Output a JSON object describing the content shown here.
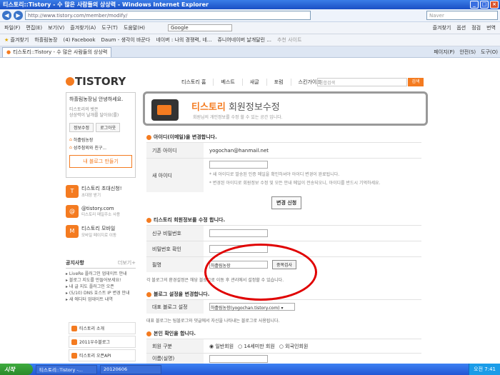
{
  "window": {
    "title": "티스토리::Tistory - 수 많은 사람들의 상상력 - Windows Internet Explorer"
  },
  "address": {
    "url": "http://www.tistory.com/member/modify/",
    "search_placeholder": "Naver"
  },
  "menubar": [
    "파일(F)",
    "편집(E)",
    "보기(V)",
    "즐겨찾기(A)",
    "도구(T)",
    "도움말(H)"
  ],
  "menubar_google": "Google",
  "menubar_right": [
    "즐겨찾기",
    "옵션",
    "점검",
    "번역"
  ],
  "favbar": {
    "label": "즐겨찾기",
    "items": [
      "하흘림농장",
      "(4) Facebook",
      "Daum - 생각이 바꾼다",
      "네이버 : 나의 경쟁력, 네...",
      "쥬니어네이버 날개달린 ...",
      "추천 사이트"
    ]
  },
  "tab": {
    "label": "티스토리::Tistory - 수 많은 사람들의 상상력",
    "tools": [
      "페이지(P)",
      "안전(S)",
      "도구(O)"
    ]
  },
  "site": {
    "logo": "TISTORY",
    "nav": [
      "티스토리 홈",
      "베스트",
      "새글",
      "포럼",
      "스킨가이드"
    ],
    "search_placeholder": "통합검색",
    "search_btn": "검색",
    "login": {
      "greet": "하흘림농장님 안녕하세요.",
      "desc1": "티스토리의 벗은",
      "desc2": "상상력이 날개를 달아요(를)",
      "btn_info": "정보수정",
      "btn_logout": "로그아웃",
      "blogs": [
        "하흘림농장",
        "성주참외와 친구..."
      ],
      "make": "내 블로그 만들기"
    },
    "promos": [
      {
        "title": "티스토리 초대신청!",
        "sub": "초대장 받기",
        "icon": "T"
      },
      {
        "title": "@tistory.com",
        "sub": "티스토리 메일주소 사용",
        "icon": "@"
      },
      {
        "title": "티스토리 모바일",
        "sub": "모바일 페이지로 이동",
        "icon": "M"
      }
    ],
    "notice": {
      "title": "공지사항",
      "more": "더보기+",
      "items": [
        "LiveRe 플러그인 업데이트 안내",
        "블로그 지도를 만들어보세요!",
        "내 글 지도 플러그인 오픈",
        "(5/10) DNS 호스트 IP 변경 안내",
        "새 에디터 업데이트 내역"
      ]
    },
    "sidelinks": [
      "티스토리 소개",
      "2011우수블로그",
      "티스토리 오픈API"
    ],
    "header": {
      "title_accent": "티스토리",
      "title_rest": " 회원정보수정",
      "sub": "회원님의 개인정보를 수정 할 수 있는 공간 입니다."
    },
    "sec1": "아이디(이메일)을 변경합니다.",
    "cur_id_label": "기존 아이디",
    "cur_id": "yogochan@hanmail.net",
    "new_id_label": "새 아이디",
    "note1": "* 새 아이디로 발송된 인증 메일을 확인하셔야 아이디 변경이 완료됩니다.",
    "note2": "* 변경된 아이디로 회원정보 수정 및 모든 안내 메일이 전송되오니, 아이디를 반드시 기억하세요.",
    "change_btn": "변경 신청",
    "sec2": "티스토리 회원정보를 수정 합니다.",
    "pw_label": "신규 비밀번호",
    "pw2_label": "비밀번호 확인",
    "nick_label": "필명",
    "nick": "하흘림농장",
    "dup_btn": "중복검사",
    "note3": "각 블로그의 환경설정은 해당 블로그로 이동 후 관리에서 설정할 수 있습니다.",
    "sec3": "블로그 설정을 변경합니다.",
    "rep_label": "대표 블로그 설정",
    "rep_value": "하흘림농장(yogochan.tistory.com)",
    "note4": "대표 블로그는 팀블로그와 댓글에서 자신을 나타내는 블로그로 사용됩니다.",
    "sec4": "본인 확인을 합니다.",
    "member_label": "회원 구분",
    "member_opts": [
      "일반회원",
      "14세미만 회원",
      "외국인회원"
    ],
    "name_label": "이름(실명)"
  },
  "taskbar": {
    "start": "시작",
    "items": [
      "티스토리::Tistory -...",
      "20120606"
    ],
    "clock": "오전 7:41"
  }
}
